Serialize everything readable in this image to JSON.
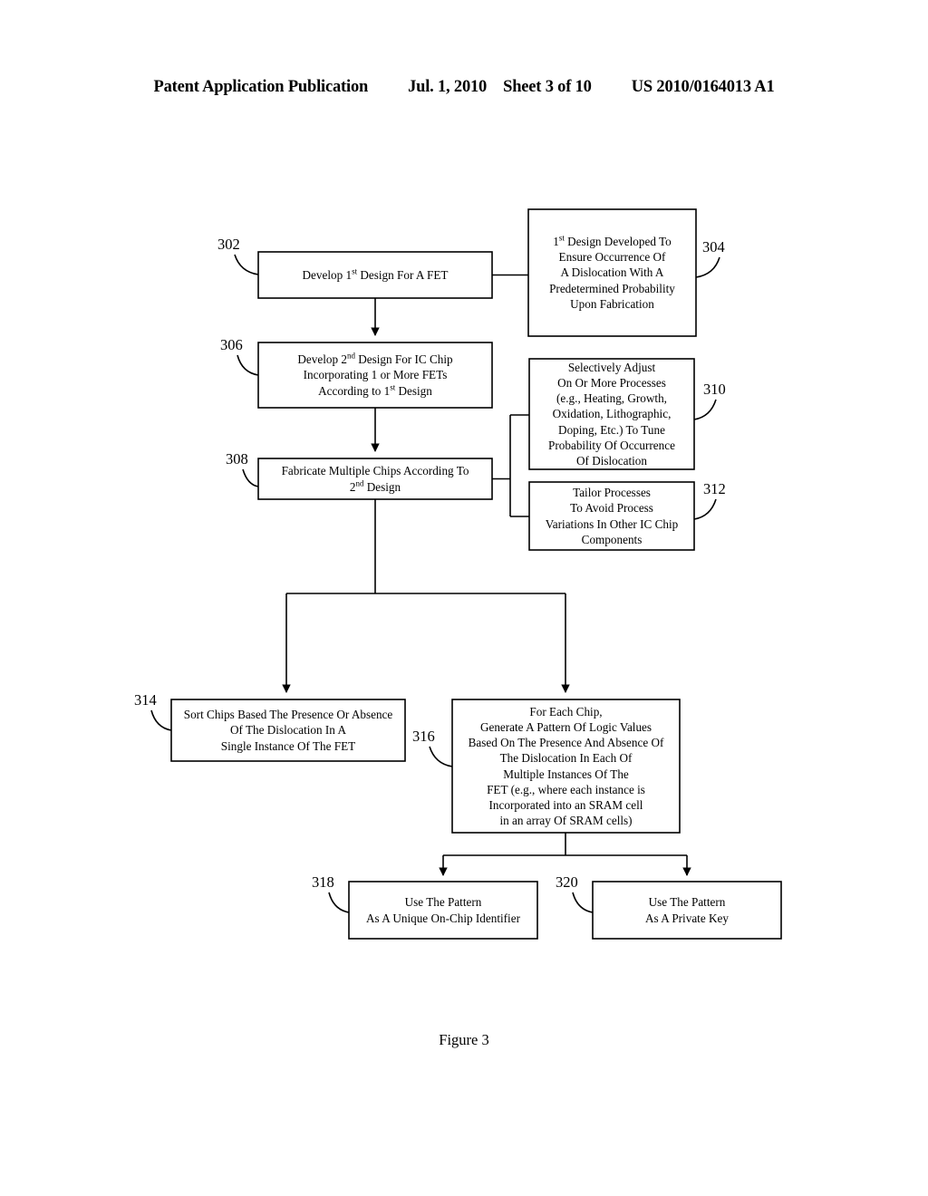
{
  "header": {
    "title": "Patent Application Publication",
    "date": "Jul. 1, 2010",
    "sheet": "Sheet 3 of 10",
    "publication_number": "US 2010/0164013 A1"
  },
  "figure": {
    "caption": "Figure 3",
    "stroke_color": "#000000",
    "fill_color": "#ffffff"
  },
  "nodes": {
    "n302": {
      "ref": "302",
      "lines": [
        "Develop 1|st| Design For A FET"
      ]
    },
    "n304": {
      "ref": "304",
      "lines": [
        "1|st| Design Developed To",
        "Ensure Occurrence Of",
        "A Dislocation With A",
        "Predetermined Probability",
        "Upon Fabrication"
      ]
    },
    "n306": {
      "ref": "306",
      "lines": [
        "Develop 2|nd| Design For IC Chip",
        "Incorporating 1 or More FETs",
        "According to 1|st| Design"
      ]
    },
    "n308": {
      "ref": "308",
      "lines": [
        "Fabricate Multiple Chips According To",
        "2|nd| Design"
      ]
    },
    "n310": {
      "ref": "310",
      "lines": [
        "Selectively Adjust",
        "On Or More Processes",
        "(e.g., Heating, Growth,",
        "Oxidation, Lithographic,",
        "Doping, Etc.) To Tune",
        "Probability Of  Occurrence",
        "Of Dislocation"
      ]
    },
    "n312": {
      "ref": "312",
      "lines": [
        "Tailor Processes",
        "To Avoid Process",
        "Variations In Other IC Chip",
        "Components"
      ]
    },
    "n314": {
      "ref": "314",
      "lines": [
        "Sort Chips Based The Presence Or Absence",
        "Of The Dislocation In A",
        "Single Instance Of The FET"
      ]
    },
    "n316": {
      "ref": "316",
      "lines": [
        "For Each Chip,",
        "Generate A Pattern Of Logic Values",
        "Based On The Presence And Absence Of",
        "The Dislocation In Each Of",
        "Multiple Instances Of The",
        "FET (e.g., where each instance is",
        "Incorporated into an SRAM cell",
        "in an array Of SRAM cells)"
      ]
    },
    "n318": {
      "ref": "318",
      "lines": [
        "Use The Pattern",
        "As A Unique On-Chip Identifier"
      ]
    },
    "n320": {
      "ref": "320",
      "lines": [
        "Use The Pattern",
        "As A Private Key"
      ]
    }
  }
}
